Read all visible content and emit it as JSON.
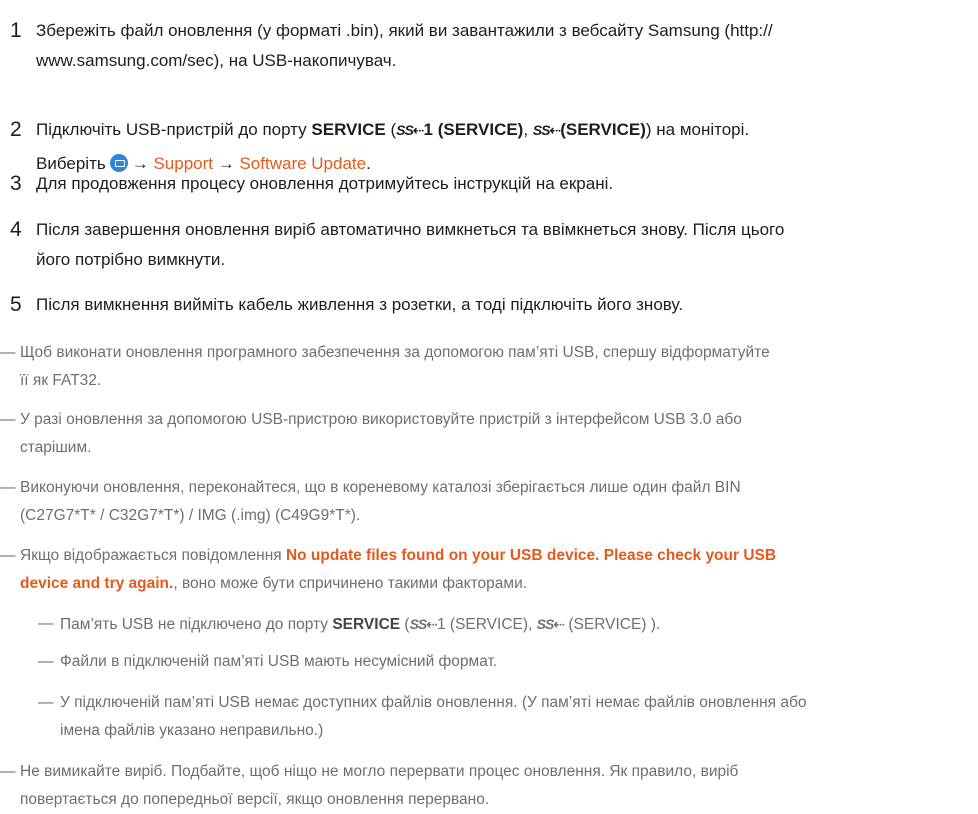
{
  "steps": [
    {
      "num": "1",
      "line1": "Збережіть файл оновлення (у форматі .bin), який ви завантажили з вебсайту Samsung (http://",
      "line2": "www.samsung.com/sec), на USB-накопичувач."
    },
    {
      "num": "2",
      "prefix": "Підключіть USB-пристрій до порту ",
      "service": "SERVICE",
      "paren_open": " (",
      "ss_symbol": "SS⇠",
      "port1": "1 (SERVICE)",
      "comma": ", ",
      "ss_symbol2": "SS⇠",
      "port2": "(SERVICE)",
      "paren_close": ")",
      "suffix": " на моніторі.",
      "select_label": "Виберіть",
      "arrow": "→",
      "support": "Support",
      "software_update": "Software Update",
      "period": "."
    },
    {
      "num": "3",
      "line1": "Для продовження процесу оновлення дотримуйтесь інструкцій на екрані."
    },
    {
      "num": "4",
      "line1": "Після завершення оновлення виріб автоматично вимкнеться та ввімкнеться знову. Після цього",
      "line2": "його потрібно вимкнути."
    },
    {
      "num": "5",
      "line1": "Після вимкнення вийміть кабель живлення з розетки, а тоді підключіть його знову."
    }
  ],
  "notes": {
    "dash": "―",
    "n1_line1": "Щоб виконати оновлення програмного забезпечення за допомогою пам’яті USB, спершу відформатуйте",
    "n1_line2": "її як FAT32.",
    "n2_line1": "У разі оновлення за допомогою USB-пристрою використовуйте пристрій з інтерфейсом USB 3.0 або",
    "n2_line2": "старішим.",
    "n3_line1": "Виконуючи оновлення, переконайтеся, що в кореневому каталозі зберігається лише один файл BIN",
    "n3_line2": "(C27G7*T* / C32G7*T*) / IMG (.img) (C49G9*T*).",
    "n4_prefix": "Якщо відображається повідомлення ",
    "n4_message_a": "No update files found on your USB device. Please check your USB",
    "n4_message_b": "device and try again.",
    "n4_suffix": ", воно може бути спричинено такими факторами.",
    "sub1_prefix": "Пам’ять USB не підключено до порту ",
    "sub1_service": "SERVICE",
    "sub1_open": " (",
    "sub1_ss": "SS⇠",
    "sub1_port1": "1 (SERVICE)",
    "sub1_comma": ", ",
    "sub1_ss2": "SS⇠",
    "sub1_port2": " (SERVICE)",
    "sub1_close": " ).",
    "sub2": "Файли в підключеній пам’яті USB мають несумісний формат.",
    "sub3_line1": "У підключеній пам’яті USB немає доступних файлів оновлення. (У пам’яті немає файлів оновлення або",
    "sub3_line2": "імена файлів указано неправильно.)",
    "n5_line1": "Не вимикайте виріб. Подбайте, щоб ніщо не могло перервати процес оновлення. Як правило, виріб",
    "n5_line2": "повертається до попередньої версії, якщо оновлення перервано."
  },
  "colors": {
    "accent": "#e35b1b",
    "text": "#1e1e1e",
    "note_text": "#6f6f6f",
    "menu_icon": "#2f86d8"
  },
  "icons": {
    "menu": "menu-icon",
    "usb_ss": "usb-superspeed-icon"
  }
}
